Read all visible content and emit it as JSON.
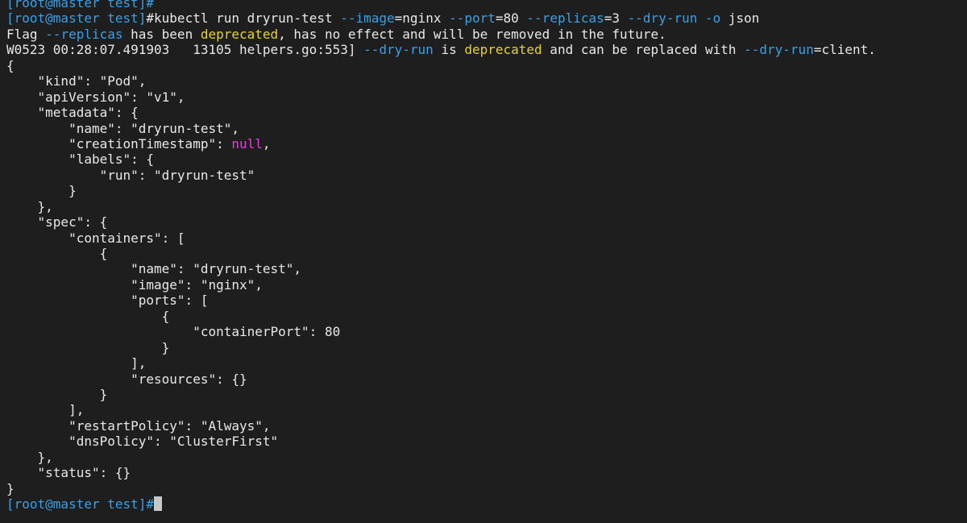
{
  "terminal": {
    "prompt": "[root@master test]",
    "prompt_char": "#",
    "colors": {
      "background": "#1e1e1e",
      "text": "#e8e8e8",
      "prompt": "#3aa0e6",
      "flag": "#3aa0e6",
      "warning_word": "#e6d32e",
      "null_literal": "#e83ce0",
      "cursor": "#c8c8c8"
    },
    "command": {
      "text_1": "kubectl run dryrun-test ",
      "flag_image": "--image",
      "text_2": "=nginx ",
      "flag_port": "--port",
      "text_3": "=80 ",
      "flag_replicas": "--replicas",
      "text_4": "=3 ",
      "flag_dryrun": "--dry-run",
      "text_5": " ",
      "flag_o": "-o",
      "text_6": " json"
    },
    "warning1": {
      "text_1": "Flag ",
      "flag": "--replicas",
      "text_2": " has been ",
      "deprecated": "deprecated",
      "text_3": ", has no effect and will be removed in the future."
    },
    "warning2": {
      "text_1": "W0523 00:28:07.491903   13105 helpers.go:553] ",
      "flag_1": "--dry-run",
      "text_2": " is ",
      "deprecated": "deprecated",
      "text_3": " and can be replaced with ",
      "flag_2": "--dry-run",
      "text_4": "=client."
    },
    "json_lines": {
      "l01": "{",
      "l02": "    \"kind\": \"Pod\",",
      "l03": "    \"apiVersion\": \"v1\",",
      "l04": "    \"metadata\": {",
      "l05": "        \"name\": \"dryrun-test\",",
      "l06_pre": "        \"creationTimestamp\": ",
      "l06_null": "null",
      "l06_post": ",",
      "l07": "        \"labels\": {",
      "l08": "            \"run\": \"dryrun-test\"",
      "l09": "        }",
      "l10": "    },",
      "l11": "    \"spec\": {",
      "l12": "        \"containers\": [",
      "l13": "            {",
      "l14": "                \"name\": \"dryrun-test\",",
      "l15": "                \"image\": \"nginx\",",
      "l16": "                \"ports\": [",
      "l17": "                    {",
      "l18": "                        \"containerPort\": 80",
      "l19": "                    }",
      "l20": "                ],",
      "l21": "                \"resources\": {}",
      "l22": "            }",
      "l23": "        ],",
      "l24": "        \"restartPolicy\": \"Always\",",
      "l25": "        \"dnsPolicy\": \"ClusterFirst\"",
      "l26": "    },",
      "l27": "    \"status\": {}",
      "l28": "}"
    }
  }
}
